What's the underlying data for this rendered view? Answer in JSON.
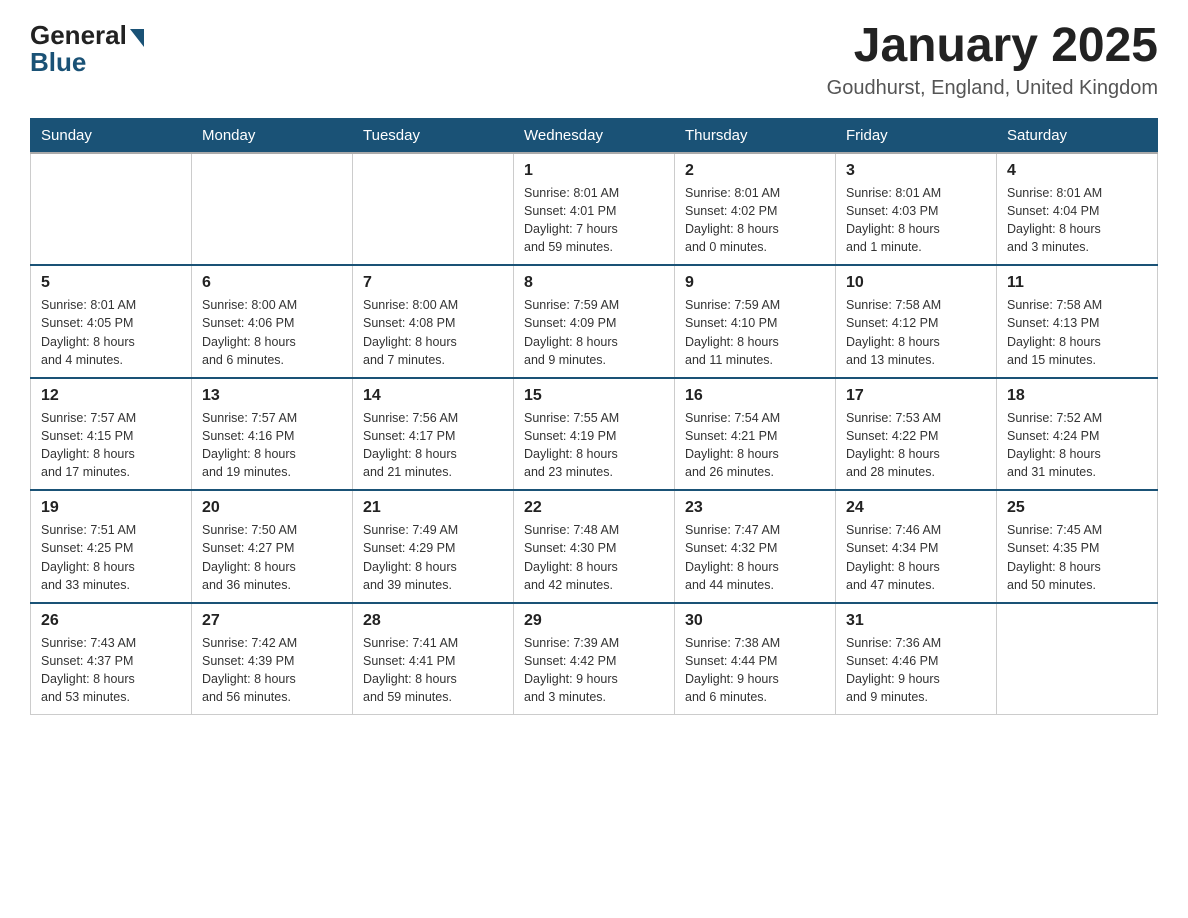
{
  "header": {
    "logo_general": "General",
    "logo_blue": "Blue",
    "title": "January 2025",
    "subtitle": "Goudhurst, England, United Kingdom"
  },
  "days_of_week": [
    "Sunday",
    "Monday",
    "Tuesday",
    "Wednesday",
    "Thursday",
    "Friday",
    "Saturday"
  ],
  "weeks": [
    [
      {
        "day": "",
        "info": ""
      },
      {
        "day": "",
        "info": ""
      },
      {
        "day": "",
        "info": ""
      },
      {
        "day": "1",
        "info": "Sunrise: 8:01 AM\nSunset: 4:01 PM\nDaylight: 7 hours\nand 59 minutes."
      },
      {
        "day": "2",
        "info": "Sunrise: 8:01 AM\nSunset: 4:02 PM\nDaylight: 8 hours\nand 0 minutes."
      },
      {
        "day": "3",
        "info": "Sunrise: 8:01 AM\nSunset: 4:03 PM\nDaylight: 8 hours\nand 1 minute."
      },
      {
        "day": "4",
        "info": "Sunrise: 8:01 AM\nSunset: 4:04 PM\nDaylight: 8 hours\nand 3 minutes."
      }
    ],
    [
      {
        "day": "5",
        "info": "Sunrise: 8:01 AM\nSunset: 4:05 PM\nDaylight: 8 hours\nand 4 minutes."
      },
      {
        "day": "6",
        "info": "Sunrise: 8:00 AM\nSunset: 4:06 PM\nDaylight: 8 hours\nand 6 minutes."
      },
      {
        "day": "7",
        "info": "Sunrise: 8:00 AM\nSunset: 4:08 PM\nDaylight: 8 hours\nand 7 minutes."
      },
      {
        "day": "8",
        "info": "Sunrise: 7:59 AM\nSunset: 4:09 PM\nDaylight: 8 hours\nand 9 minutes."
      },
      {
        "day": "9",
        "info": "Sunrise: 7:59 AM\nSunset: 4:10 PM\nDaylight: 8 hours\nand 11 minutes."
      },
      {
        "day": "10",
        "info": "Sunrise: 7:58 AM\nSunset: 4:12 PM\nDaylight: 8 hours\nand 13 minutes."
      },
      {
        "day": "11",
        "info": "Sunrise: 7:58 AM\nSunset: 4:13 PM\nDaylight: 8 hours\nand 15 minutes."
      }
    ],
    [
      {
        "day": "12",
        "info": "Sunrise: 7:57 AM\nSunset: 4:15 PM\nDaylight: 8 hours\nand 17 minutes."
      },
      {
        "day": "13",
        "info": "Sunrise: 7:57 AM\nSunset: 4:16 PM\nDaylight: 8 hours\nand 19 minutes."
      },
      {
        "day": "14",
        "info": "Sunrise: 7:56 AM\nSunset: 4:17 PM\nDaylight: 8 hours\nand 21 minutes."
      },
      {
        "day": "15",
        "info": "Sunrise: 7:55 AM\nSunset: 4:19 PM\nDaylight: 8 hours\nand 23 minutes."
      },
      {
        "day": "16",
        "info": "Sunrise: 7:54 AM\nSunset: 4:21 PM\nDaylight: 8 hours\nand 26 minutes."
      },
      {
        "day": "17",
        "info": "Sunrise: 7:53 AM\nSunset: 4:22 PM\nDaylight: 8 hours\nand 28 minutes."
      },
      {
        "day": "18",
        "info": "Sunrise: 7:52 AM\nSunset: 4:24 PM\nDaylight: 8 hours\nand 31 minutes."
      }
    ],
    [
      {
        "day": "19",
        "info": "Sunrise: 7:51 AM\nSunset: 4:25 PM\nDaylight: 8 hours\nand 33 minutes."
      },
      {
        "day": "20",
        "info": "Sunrise: 7:50 AM\nSunset: 4:27 PM\nDaylight: 8 hours\nand 36 minutes."
      },
      {
        "day": "21",
        "info": "Sunrise: 7:49 AM\nSunset: 4:29 PM\nDaylight: 8 hours\nand 39 minutes."
      },
      {
        "day": "22",
        "info": "Sunrise: 7:48 AM\nSunset: 4:30 PM\nDaylight: 8 hours\nand 42 minutes."
      },
      {
        "day": "23",
        "info": "Sunrise: 7:47 AM\nSunset: 4:32 PM\nDaylight: 8 hours\nand 44 minutes."
      },
      {
        "day": "24",
        "info": "Sunrise: 7:46 AM\nSunset: 4:34 PM\nDaylight: 8 hours\nand 47 minutes."
      },
      {
        "day": "25",
        "info": "Sunrise: 7:45 AM\nSunset: 4:35 PM\nDaylight: 8 hours\nand 50 minutes."
      }
    ],
    [
      {
        "day": "26",
        "info": "Sunrise: 7:43 AM\nSunset: 4:37 PM\nDaylight: 8 hours\nand 53 minutes."
      },
      {
        "day": "27",
        "info": "Sunrise: 7:42 AM\nSunset: 4:39 PM\nDaylight: 8 hours\nand 56 minutes."
      },
      {
        "day": "28",
        "info": "Sunrise: 7:41 AM\nSunset: 4:41 PM\nDaylight: 8 hours\nand 59 minutes."
      },
      {
        "day": "29",
        "info": "Sunrise: 7:39 AM\nSunset: 4:42 PM\nDaylight: 9 hours\nand 3 minutes."
      },
      {
        "day": "30",
        "info": "Sunrise: 7:38 AM\nSunset: 4:44 PM\nDaylight: 9 hours\nand 6 minutes."
      },
      {
        "day": "31",
        "info": "Sunrise: 7:36 AM\nSunset: 4:46 PM\nDaylight: 9 hours\nand 9 minutes."
      },
      {
        "day": "",
        "info": ""
      }
    ]
  ]
}
